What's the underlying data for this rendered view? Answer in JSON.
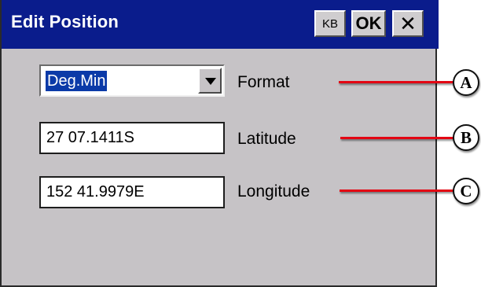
{
  "window": {
    "title": "Edit Position"
  },
  "titlebar": {
    "kb_label": "KB",
    "ok_label": "OK",
    "close_label": "✕"
  },
  "format": {
    "value": "Deg.Min",
    "label": "Format"
  },
  "latitude": {
    "value": "27 07.1411S",
    "label": "Latitude"
  },
  "longitude": {
    "value": "152 41.9979E",
    "label": "Longitude"
  },
  "callouts": [
    "A",
    "B",
    "C"
  ],
  "colors": {
    "titlebar": "#0a1c8c",
    "dialog_bg": "#c6c3c6",
    "callout_line": "#e30613"
  }
}
